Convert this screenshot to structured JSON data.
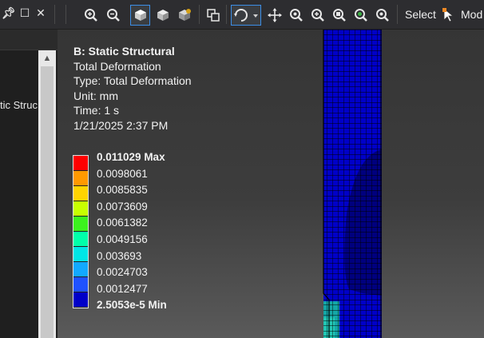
{
  "toolbar": {
    "select_label": "Select",
    "mode_label": "Mod"
  },
  "tree": {
    "partial_item_label": "tic Struc"
  },
  "result": {
    "title": "B: Static Structural",
    "result_name": "Total Deformation",
    "type_line": "Type: Total Deformation",
    "unit_line": "Unit: mm",
    "time_line": "Time: 1 s",
    "date_line": "1/21/2025 2:37 PM"
  },
  "legend": {
    "max_label": "0.011029 Max",
    "min_label": "2.5053e-5 Min",
    "levels": [
      "0.0098061",
      "0.0085835",
      "0.0073609",
      "0.0061382",
      "0.0049156",
      "0.003693",
      "0.0024703",
      "0.0012477"
    ],
    "colors": [
      "#ff0000",
      "#ff9900",
      "#ffd400",
      "#c8ff00",
      "#3cf21e",
      "#00ffaa",
      "#00e6e6",
      "#12a9ff",
      "#1f52ff",
      "#0000c8"
    ]
  },
  "icons": [
    "pin-icon",
    "restore-icon",
    "close-icon",
    "zoom-in-icon",
    "zoom-out-icon",
    "iso-view-icon",
    "cube-view-icon",
    "shaded-view-icon",
    "window-icon",
    "rotate-icon",
    "pan-icon",
    "zoom-box-icon",
    "zoom-fit-icon",
    "zoom-region-icon",
    "zoom-selected-icon",
    "zoom-mode-icon",
    "select-cursor-icon"
  ]
}
